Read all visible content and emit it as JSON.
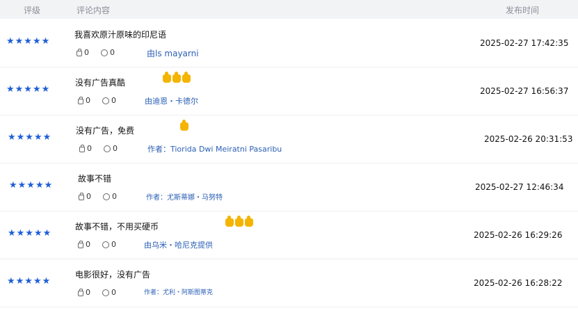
{
  "header": {
    "rating": "评级",
    "content": "评论内容",
    "time": "发布时间"
  },
  "colors": {
    "star": "#1f5fd6",
    "author_link": "#2a5fb5",
    "header_bg": "#f2f3f5"
  },
  "rows": [
    {
      "stars": "★★★★★",
      "rating": 5,
      "comment": "我喜欢原汁原味的印尼语",
      "emoji_count": 0,
      "likes": "0",
      "replies": "0",
      "author": "由ls mayarni",
      "time": "2025-02-27 17:42:35"
    },
    {
      "stars": "★★★★★",
      "rating": 5,
      "comment": "没有广告真酷",
      "emoji_count": 3,
      "likes": "0",
      "replies": "0",
      "author": "由迪恩・卡德尔",
      "time": "2025-02-27 16:56:37"
    },
    {
      "stars": "★★★★★",
      "rating": 5,
      "comment": "没有广告，免费",
      "emoji_count": 1,
      "likes": "0",
      "replies": "0",
      "author": "作者：Tiorida Dwi Meiratni Pasaribu",
      "time": "2025-02-26 20:31:53"
    },
    {
      "stars": "★★★★★",
      "rating": 5,
      "comment": "故事不错",
      "emoji_count": 0,
      "likes": "0",
      "replies": "0",
      "author": "作者：尤斯蒂娜・马努特",
      "time": "2025-02-27 12:46:34"
    },
    {
      "stars": "★★★★★",
      "rating": 5,
      "comment": "故事不错，不用买硬币",
      "emoji_count": 3,
      "likes": "0",
      "replies": "0",
      "author": "由乌米・哈尼克提供",
      "time": "2025-02-26 16:29:26"
    },
    {
      "stars": "★★★★★",
      "rating": 5,
      "comment": "电影很好，没有广告",
      "emoji_count": 0,
      "likes": "0",
      "replies": "0",
      "author": "作者：尤利・阿斯图蒂克",
      "time": "2025-02-26 16:28:22"
    }
  ]
}
